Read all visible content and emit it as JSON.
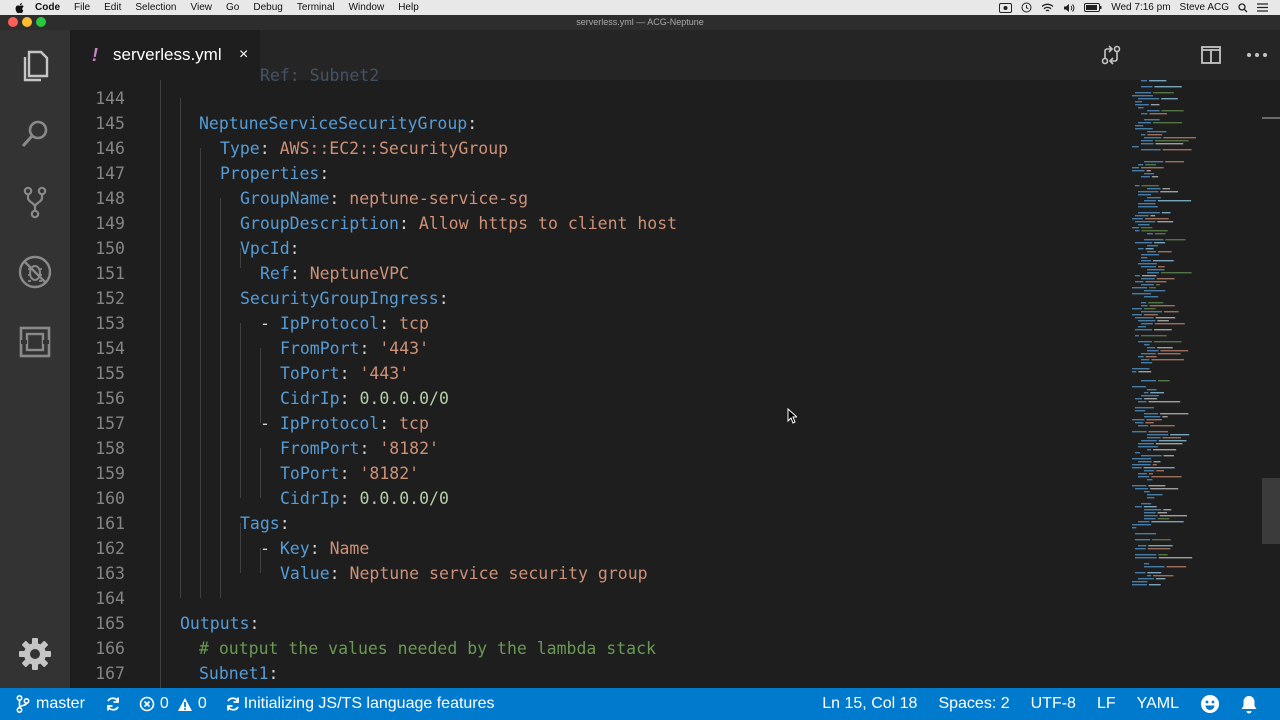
{
  "menubar": {
    "app": "Code",
    "items": [
      "File",
      "Edit",
      "Selection",
      "View",
      "Go",
      "Debug",
      "Terminal",
      "Window",
      "Help"
    ],
    "clock": "Wed 7:16 pm",
    "user": "Steve ACG"
  },
  "window": {
    "title": "serverless.yml — ACG-Neptune"
  },
  "tab": {
    "modified_mark": "!",
    "label": "serverless.yml",
    "close": "×"
  },
  "editor": {
    "lines": [
      {
        "n": "144"
      },
      {
        "n": "145",
        "key": "NeptuneServiceSecurityGroup",
        "colon": ":"
      },
      {
        "n": "146",
        "key": "Type",
        "colon": ":",
        "val": "AWS::EC2::SecurityGroup"
      },
      {
        "n": "147",
        "key": "Properties",
        "colon": ":"
      },
      {
        "n": "148",
        "key": "GroupName",
        "colon": ":",
        "val": "neptune-service-sg"
      },
      {
        "n": "149",
        "key": "GroupDescription",
        "colon": ":",
        "val": "Allow https to client host"
      },
      {
        "n": "150",
        "key": "VpcId",
        "colon": ":"
      },
      {
        "n": "151",
        "key": "Ref",
        "colon": ":",
        "val": "NeptuneVPC"
      },
      {
        "n": "152",
        "key": "SecurityGroupIngress",
        "colon": ":"
      },
      {
        "n": "153",
        "dash": "- ",
        "key": "IpProtocol",
        "colon": ":",
        "val": "tcp"
      },
      {
        "n": "154",
        "key": "FromPort",
        "colon": ":",
        "val": "'443'"
      },
      {
        "n": "155",
        "key": "ToPort",
        "colon": ":",
        "val": "'443'"
      },
      {
        "n": "156",
        "key": "CidrIp",
        "colon": ":",
        "val": "0.0.0.0/0"
      },
      {
        "n": "157",
        "dash": "- ",
        "key": "IpProtocol",
        "colon": ":",
        "val": "tcp"
      },
      {
        "n": "158",
        "key": "FromPort",
        "colon": ":",
        "val": "'8182'"
      },
      {
        "n": "159",
        "key": "ToPort",
        "colon": ":",
        "val": "'8182'"
      },
      {
        "n": "160",
        "key": "CidrIp",
        "colon": ":",
        "val": "0.0.0.0/0"
      },
      {
        "n": "161",
        "key": "Tags",
        "colon": ":"
      },
      {
        "n": "162",
        "dash": "- ",
        "key": "Key",
        "colon": ":",
        "val": "Name"
      },
      {
        "n": "163",
        "key": "Value",
        "colon": ":",
        "val": "Neptune service security group"
      },
      {
        "n": "164"
      },
      {
        "n": "165",
        "key": "Outputs",
        "colon": ":"
      },
      {
        "n": "166",
        "comment": "# output the values needed by the lambda stack"
      },
      {
        "n": "167",
        "key": "Subnet1",
        "colon": ":"
      }
    ]
  },
  "statusbar": {
    "branch": "master",
    "errors": "0",
    "warnings": "0",
    "message": "Initializing JS/TS language features",
    "position": "Ln 15, Col 18",
    "spaces": "Spaces: 2",
    "encoding": "UTF-8",
    "eol": "LF",
    "language": "YAML"
  },
  "colors": {
    "key": "#569cd6",
    "string": "#ce9178",
    "comment": "#6a9955",
    "status": "#007acc"
  },
  "icons": [
    "apple-icon",
    "explorer-icon",
    "search-icon",
    "source-control-icon",
    "debug-icon",
    "extensions-icon",
    "settings-gear-icon",
    "compare-changes-icon",
    "split-editor-icon",
    "more-actions-icon",
    "git-branch-icon",
    "sync-icon",
    "error-icon",
    "warning-icon",
    "smiley-icon",
    "bell-icon"
  ]
}
